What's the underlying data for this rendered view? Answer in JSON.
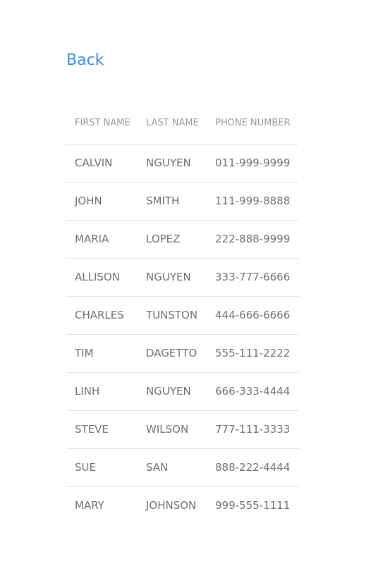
{
  "nav": {
    "back_label": "Back"
  },
  "table": {
    "headers": [
      "FIRST NAME",
      "LAST NAME",
      "PHONE NUMBER"
    ],
    "rows": [
      [
        "CALVIN",
        "NGUYEN",
        "011-999-9999"
      ],
      [
        "JOHN",
        "SMITH",
        "111-999-8888"
      ],
      [
        "MARIA",
        "LOPEZ",
        "222-888-9999"
      ],
      [
        "ALLISON",
        "NGUYEN",
        "333-777-6666"
      ],
      [
        "CHARLES",
        "TUNSTON",
        "444-666-6666"
      ],
      [
        "TIM",
        "DAGETTO",
        "555-111-2222"
      ],
      [
        "LINH",
        "NGUYEN",
        "666-333-4444"
      ],
      [
        "STEVE",
        "WILSON",
        "777-111-3333"
      ],
      [
        "SUE",
        "SAN",
        "888-222-4444"
      ],
      [
        "MARY",
        "JOHNSON",
        "999-555-1111"
      ]
    ]
  },
  "colors": {
    "link": "#3b8bea",
    "text": "#6f6f6f",
    "header_text": "#9a9a9a",
    "divider": "#e4e4e4"
  }
}
